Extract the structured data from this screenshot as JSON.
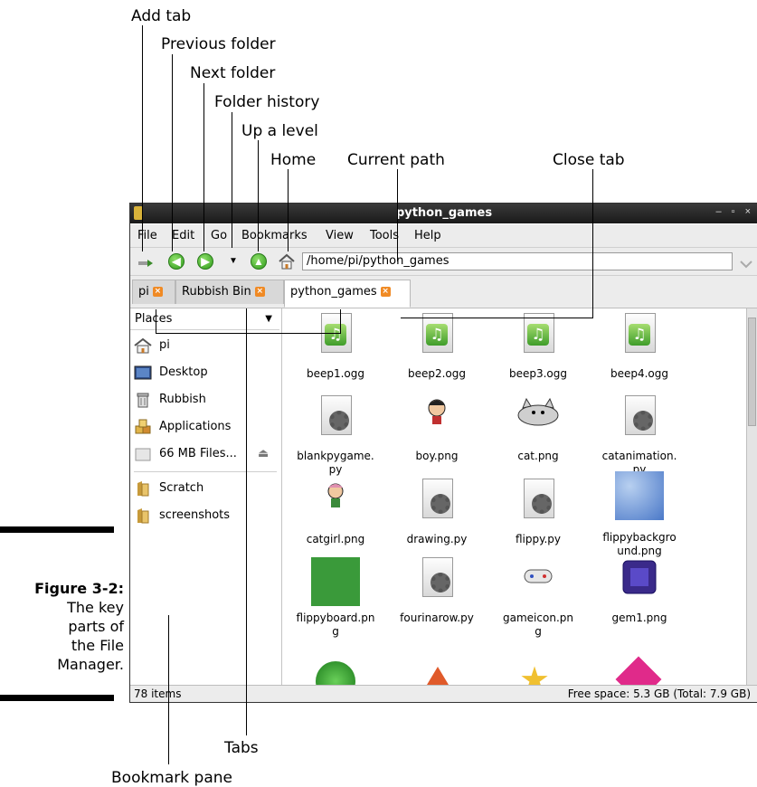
{
  "callouts": {
    "add_tab": "Add tab",
    "previous_folder": "Previous folder",
    "next_folder": "Next folder",
    "folder_history": "Folder history",
    "up_a_level": "Up a level",
    "home": "Home",
    "current_path": "Current path",
    "close_tab": "Close tab",
    "tabs": "Tabs",
    "bookmark_pane": "Bookmark pane"
  },
  "figure": {
    "number": "Figure 3-2:",
    "caption_lines": [
      "The key",
      "parts of",
      "the File",
      "Manager."
    ]
  },
  "window": {
    "title": "python_games",
    "controls": "– ▫ ×"
  },
  "menu": [
    "File",
    "Edit",
    "Go",
    "Bookmarks",
    "View",
    "Tools",
    "Help"
  ],
  "toolbar": {
    "path": "/home/pi/python_games"
  },
  "tabs": [
    {
      "label": "pi",
      "active": false
    },
    {
      "label": "Rubbish Bin",
      "active": false
    },
    {
      "label": "python_games",
      "active": true
    }
  ],
  "places": {
    "header": "Places",
    "items": [
      {
        "label": "pi",
        "icon": "home-icon"
      },
      {
        "label": "Desktop",
        "icon": "desktop-icon"
      },
      {
        "label": "Rubbish",
        "icon": "trash-icon"
      },
      {
        "label": "Applications",
        "icon": "applications-icon"
      },
      {
        "label": "66 MB Files...",
        "icon": "drive-icon"
      }
    ],
    "bookmarks": [
      {
        "label": "Scratch",
        "icon": "folder-icon"
      },
      {
        "label": "screenshots",
        "icon": "folder-icon"
      }
    ]
  },
  "files": [
    {
      "name": "beep1.ogg",
      "icon": "audio"
    },
    {
      "name": "beep2.ogg",
      "icon": "audio"
    },
    {
      "name": "beep3.ogg",
      "icon": "audio"
    },
    {
      "name": "beep4.ogg",
      "icon": "audio"
    },
    {
      "name": "blankpygame.\npy",
      "icon": "script"
    },
    {
      "name": "boy.png",
      "icon": "boy"
    },
    {
      "name": "cat.png",
      "icon": "cat"
    },
    {
      "name": "catanimation.\npy",
      "icon": "script"
    },
    {
      "name": "catgirl.png",
      "icon": "catgirl"
    },
    {
      "name": "drawing.py",
      "icon": "script"
    },
    {
      "name": "flippy.py",
      "icon": "script"
    },
    {
      "name": "flippybackgro\nund.png",
      "icon": "sky"
    },
    {
      "name": "flippyboard.pn\ng",
      "icon": "green"
    },
    {
      "name": "fourinarow.py",
      "icon": "script"
    },
    {
      "name": "gameicon.pn\ng",
      "icon": "gamepad"
    },
    {
      "name": "gem1.png",
      "icon": "gem"
    }
  ],
  "status": {
    "items": "78 items",
    "free_space": "Free space: 5.3 GB (Total: 7.9 GB)"
  }
}
